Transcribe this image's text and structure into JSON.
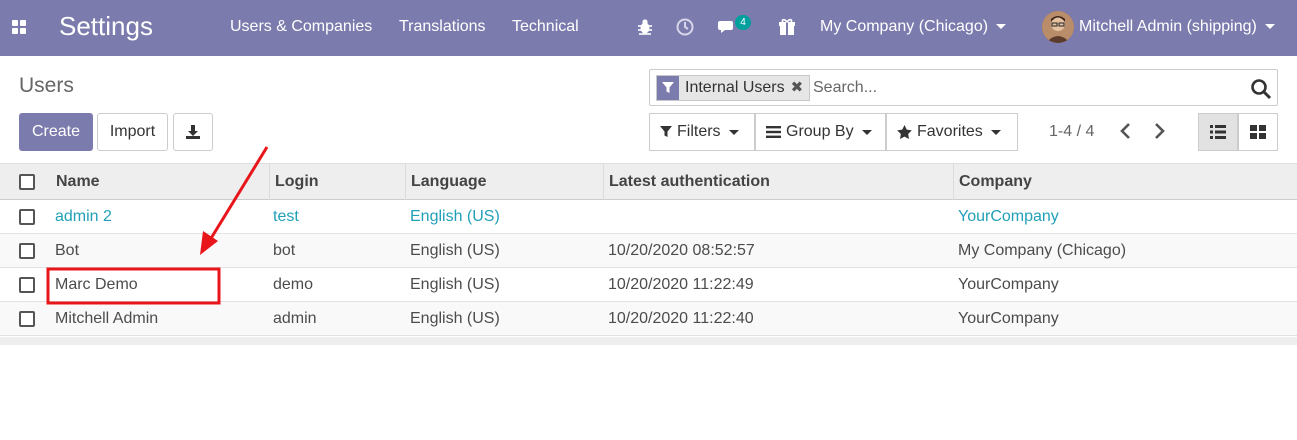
{
  "navbar": {
    "app_title": "Settings",
    "menus": [
      {
        "label": "Users & Companies"
      },
      {
        "label": "Translations"
      },
      {
        "label": "Technical"
      }
    ],
    "icons": [
      "apps-grid-icon",
      "bug-icon",
      "clock-icon",
      "chat-icon",
      "gift-icon"
    ],
    "messages_count": "4",
    "company_switcher": "My Company (Chicago)",
    "user_menu": "Mitchell Admin (shipping)"
  },
  "control_panel": {
    "breadcrumb": "Users",
    "create_label": "Create",
    "import_label": "Import",
    "search": {
      "facet_label": "Internal Users",
      "placeholder": "Search..."
    },
    "filters_label": "Filters",
    "group_by_label": "Group By",
    "favorites_label": "Favorites",
    "pager_text": "1-4 / 4"
  },
  "table": {
    "columns": [
      "Name",
      "Login",
      "Language",
      "Latest authentication",
      "Company"
    ],
    "rows": [
      {
        "name": "admin 2",
        "login": "test",
        "language": "English (US)",
        "latest_auth": "",
        "company": "YourCompany"
      },
      {
        "name": "Bot",
        "login": "bot",
        "language": "English (US)",
        "latest_auth": "10/20/2020 08:52:57",
        "company": "My Company (Chicago)"
      },
      {
        "name": "Marc Demo",
        "login": "demo",
        "language": "English (US)",
        "latest_auth": "10/20/2020 11:22:49",
        "company": "YourCompany"
      },
      {
        "name": "Mitchell Admin",
        "login": "admin",
        "language": "English (US)",
        "latest_auth": "10/20/2020 11:22:40",
        "company": "YourCompany"
      }
    ]
  },
  "colors": {
    "navbar": "#7c7bad",
    "link": "#21a0b8",
    "badge": "#00a09d",
    "annotation": "#e8151b"
  }
}
